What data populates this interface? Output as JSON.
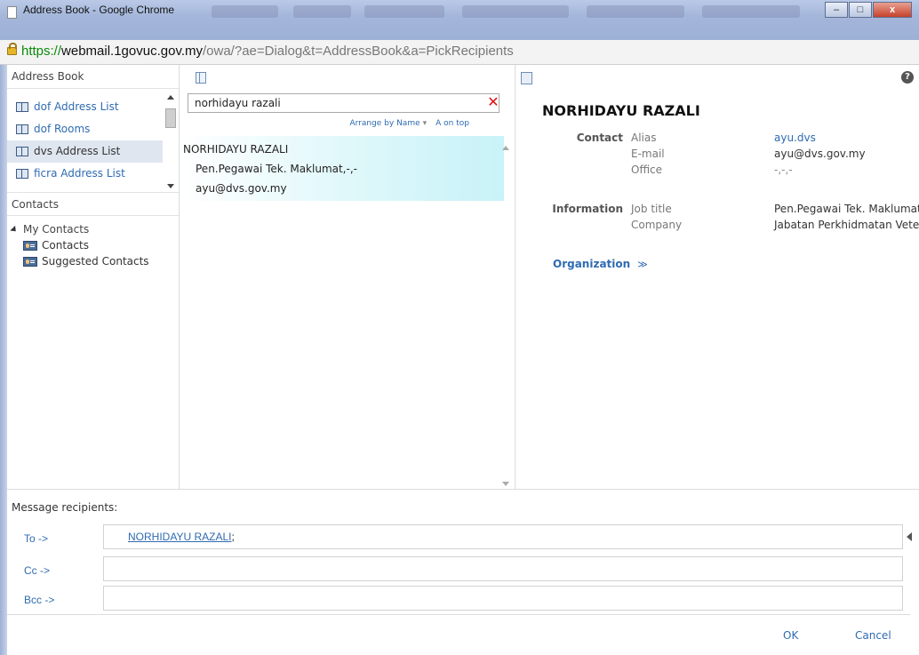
{
  "window": {
    "title": "Address Book - Google Chrome",
    "minimize": "–",
    "maximize": "□",
    "close": "x"
  },
  "urlbar": {
    "proto": "https://",
    "host": "webmail.1govuc.gov.my",
    "path": "/owa/?ae=Dialog&t=AddressBook&a=PickRecipients"
  },
  "address_book": {
    "header": "Address Book",
    "items": [
      {
        "label": "dof Address List"
      },
      {
        "label": "dof Rooms"
      },
      {
        "label": "dvs Address List",
        "selected": true
      },
      {
        "label": "ficra Address List"
      }
    ]
  },
  "contacts": {
    "header": "Contacts",
    "root": "My Contacts",
    "items": [
      {
        "label": "Contacts"
      },
      {
        "label": "Suggested Contacts"
      }
    ]
  },
  "search": {
    "value": "norhidayu razali",
    "arrange_label": "Arrange by Name",
    "order_label": "A on top"
  },
  "results": [
    {
      "name": "NORHIDAYU RAZALI",
      "title_line": "Pen.Pegawai Tek. Maklumat,-,-",
      "email": "ayu@dvs.gov.my"
    }
  ],
  "detail": {
    "name": "NORHIDAYU RAZALI",
    "contact_section": "Contact",
    "information_section": "Information",
    "fields": {
      "alias_label": "Alias",
      "alias_value": "ayu.dvs",
      "email_label": "E-mail",
      "email_value": "ayu@dvs.gov.my",
      "office_label": "Office",
      "office_value": "-,-,-",
      "job_label": "Job title",
      "job_value": "Pen.Pegawai Tek. Maklumat",
      "company_label": "Company",
      "company_value": "Jabatan Perkhidmatan Veterinar"
    },
    "organization_label": "Organization",
    "organization_icon": "»"
  },
  "recipients": {
    "label": "Message recipients:",
    "to_label": "To ->",
    "to_value": "NORHIDAYU RAZALI",
    "to_separator": ";",
    "cc_label": "Cc ->",
    "cc_value": "",
    "bcc_label": "Bcc ->",
    "bcc_value": ""
  },
  "actions": {
    "ok": "OK",
    "cancel": "Cancel"
  }
}
